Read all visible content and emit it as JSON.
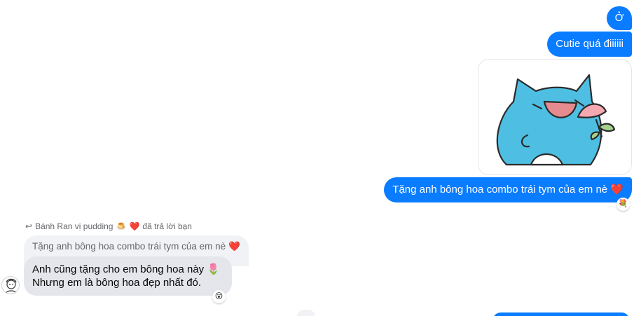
{
  "colors": {
    "outgoing_bubble": "#0a7cff",
    "incoming_bubble": "#e4e6eb",
    "quoted_bubble": "#f0f2f5",
    "heart": "#e41e3f"
  },
  "outgoing": {
    "msg1": "Ở",
    "msg2": "Cutie quá điiiiii",
    "sticker": "blue-cat-with-flower-sticker",
    "msg3": "Tặng anh bông hoa combo trái tym của em nè",
    "msg3_emoji": "❤️",
    "msg3_reaction": "💐"
  },
  "reply": {
    "icon": "reply-arrow-icon",
    "sender": "Bánh Ran vị pudding",
    "sender_emoji": "🍮",
    "sender_heart": "❤️",
    "suffix": "đã trả lời bạn",
    "quoted_text": "Tặng anh bông hoa combo trái tym của em nè",
    "quoted_emoji": "❤️"
  },
  "incoming": {
    "line1": "Anh cũng tặng cho em bông hoa này",
    "line1_emoji": "🌷",
    "line2": "Nhưng em là bông hoa đẹp nhất đó.",
    "reaction": "😮",
    "avatar": "user-avatar-sketch"
  }
}
